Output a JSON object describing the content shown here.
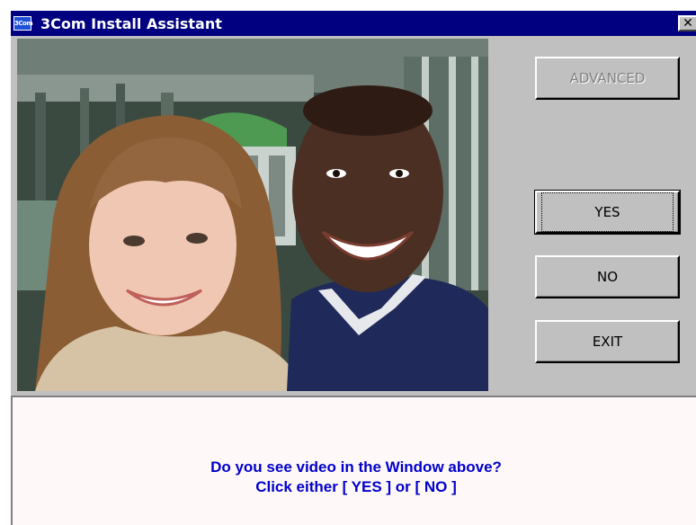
{
  "window": {
    "title": "3Com Install Assistant",
    "icon_label": "3Com",
    "close_glyph": "✕"
  },
  "video": {
    "content": "webcam preview of two smiling people"
  },
  "buttons": {
    "advanced": "ADVANCED",
    "yes": "YES",
    "no": "NO",
    "exit": "EXIT"
  },
  "message": {
    "line1": "Do you see video in the Window above?",
    "line2": "Click either [ YES ] or [ NO ]"
  },
  "colors": {
    "titlebar": "#000080",
    "message_text": "#0000cc",
    "dialog_face": "#c0c0c0"
  }
}
